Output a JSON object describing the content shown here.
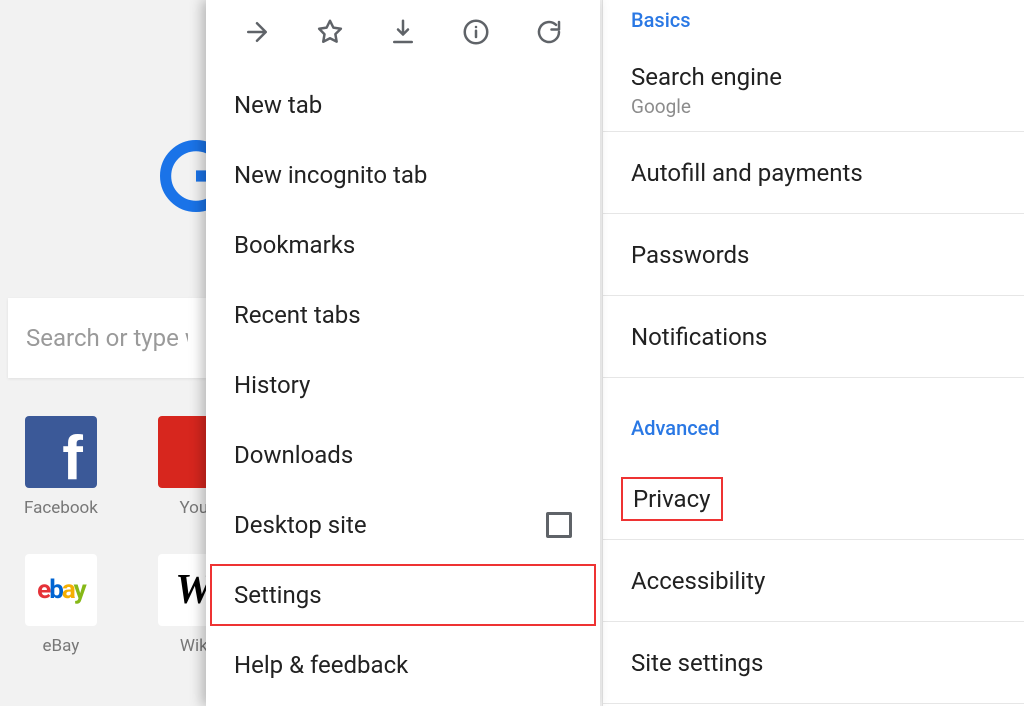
{
  "newtab": {
    "search_placeholder": "Search or type web address",
    "tiles": [
      {
        "id": "facebook",
        "label": "Facebook"
      },
      {
        "id": "youtube",
        "label": "YouTube"
      },
      {
        "id": "ebay",
        "label": "eBay"
      },
      {
        "id": "wikipedia",
        "label": "Wikipedia"
      }
    ],
    "tiles_label_visible": {
      "facebook": "Facebook",
      "youtube": "You",
      "ebay": "eBay",
      "wikipedia": "Wik"
    }
  },
  "menu": {
    "items": {
      "new_tab": "New tab",
      "new_incognito": "New incognito tab",
      "bookmarks": "Bookmarks",
      "recent_tabs": "Recent tabs",
      "history": "History",
      "downloads": "Downloads",
      "desktop_site": "Desktop site",
      "settings": "Settings",
      "help_feedback": "Help & feedback"
    },
    "desktop_site_checked": false,
    "highlighted": "settings"
  },
  "settings": {
    "sections": {
      "basics": "Basics",
      "advanced": "Advanced"
    },
    "basics_items": {
      "search_engine": {
        "title": "Search engine",
        "sub": "Google"
      },
      "autofill": {
        "title": "Autofill and payments"
      },
      "passwords": {
        "title": "Passwords"
      },
      "notifications": {
        "title": "Notifications"
      }
    },
    "advanced_items": {
      "privacy": {
        "title": "Privacy"
      },
      "accessibility": {
        "title": "Accessibility"
      },
      "site_settings": {
        "title": "Site settings"
      }
    },
    "highlighted": "privacy"
  }
}
